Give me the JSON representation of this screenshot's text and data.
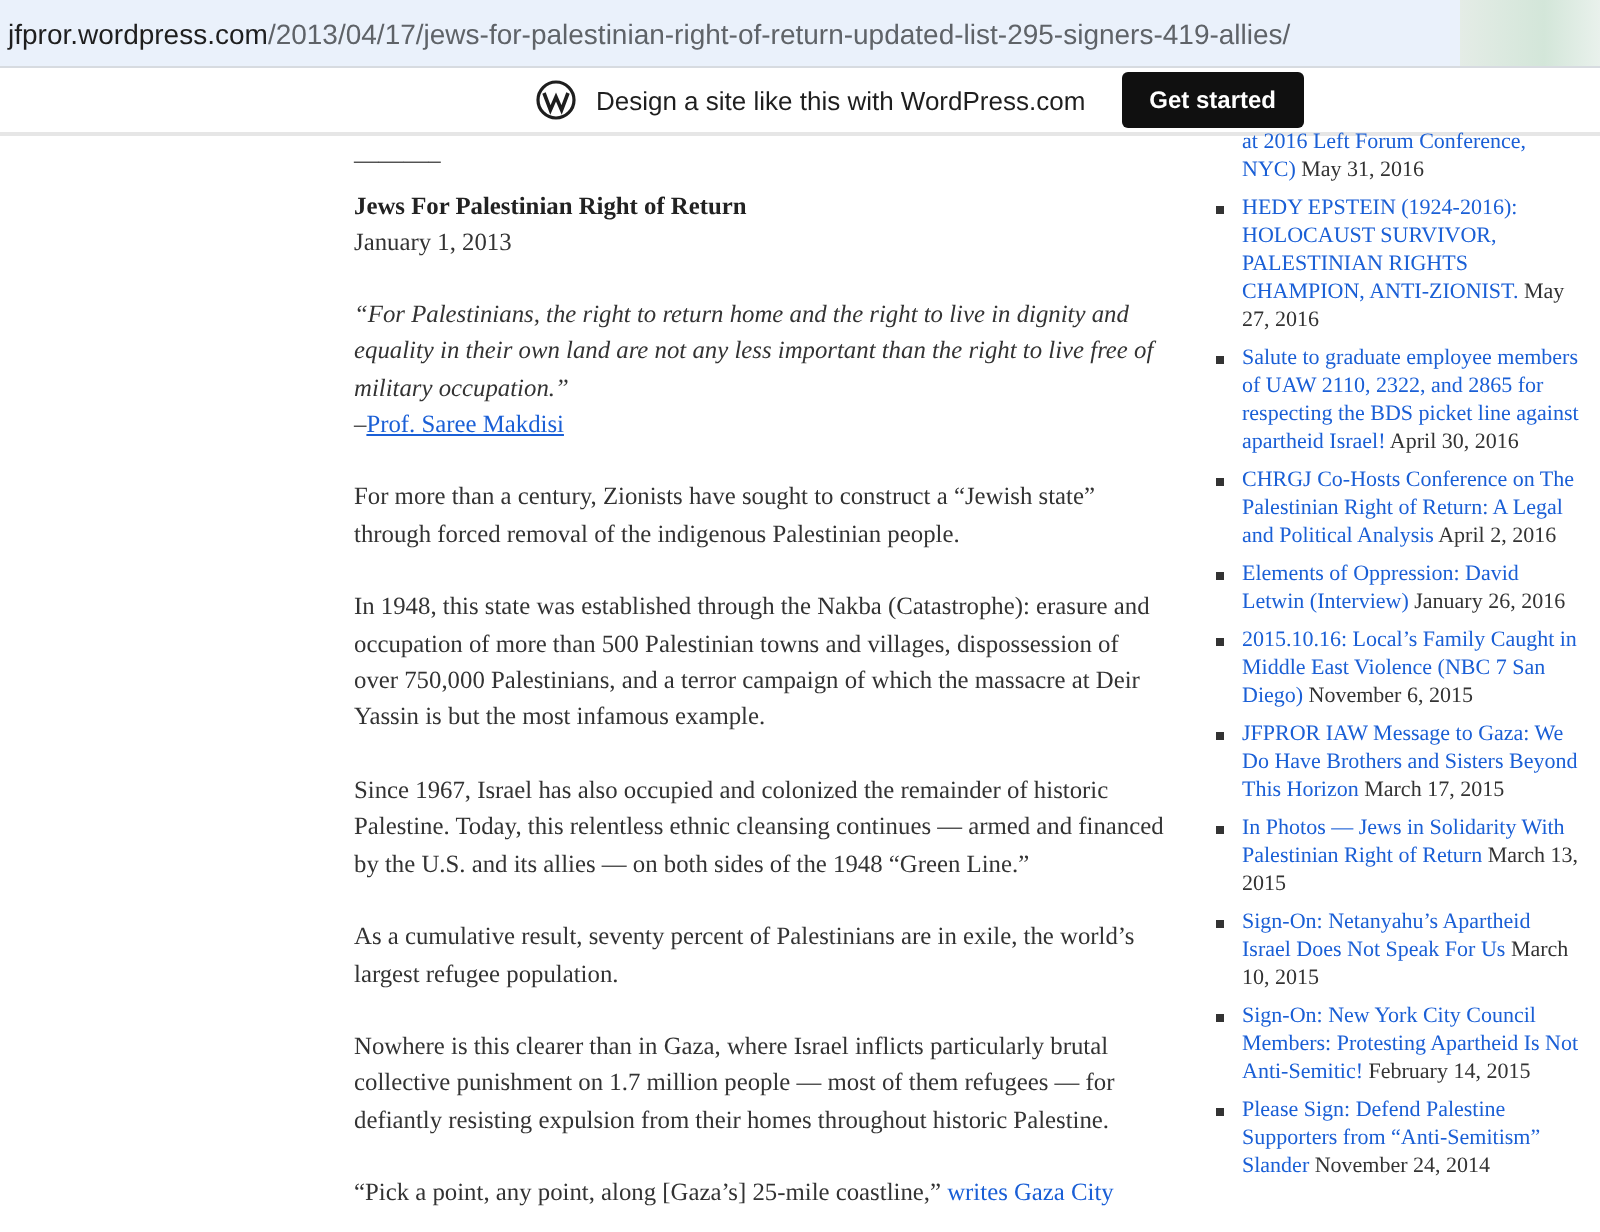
{
  "address_bar": {
    "host": "jfpror.wordpress.com",
    "path": "/2013/04/17/jews-for-palestinian-right-of-return-updated-list-295-signers-419-allies/"
  },
  "banner": {
    "text": "Design a site like this with WordPress.com",
    "button": "Get started"
  },
  "article": {
    "rule": "———–",
    "signer": "Jews For Palestinian Right of Return",
    "date": "January 1, 2013",
    "quote": "“For Palestinians, the right to return home and the right to live in dignity and equality in their own land are not any less important than the right to live free of military occupation.”",
    "attribution": {
      "dash": "–",
      "link": "Prof. Saree Makdisi"
    },
    "paragraphs": [
      {
        "text": "For more than a century, Zionists have sought to construct a “Jewish state” through forced removal of the indigenous Palestinian people."
      },
      {
        "text": "In 1948, this state was established through the Nakba (Catastrophe): erasure and occupation of more than 500 Palestinian towns and villages, dispossession of over 750,000 Palestinians, and a terror campaign of which the massacre at Deir Yassin is but the most infamous example."
      },
      {
        "text": "Since 1967, Israel has also occupied and colonized the remainder of historic Palestine. Today, this relentless ethnic cleansing continues — armed and financed by the U.S. and its allies — on both sides of the 1948 “Green Line.”"
      },
      {
        "text": "As a cumulative result, seventy percent of Palestinians are in exile, the world’s largest refugee population."
      },
      {
        "text": "Nowhere is this clearer than in Gaza, where Israel inflicts particularly brutal collective punishment on 1.7 million people — most of them refugees — for defiantly resisting expulsion from their homes throughout historic Palestine."
      },
      {
        "text": "“Pick a point, any point, along [Gaza’s] 25-mile coastline,” ",
        "link": "writes Gaza City"
      }
    ]
  },
  "sidebar": {
    "top_item": {
      "link": "at 2016 Left Forum Conference, NYC)",
      "date": "May 31, 2016"
    },
    "items": [
      {
        "link": "HEDY EPSTEIN (1924-2016): HOLOCAUST SURVIVOR, PALESTINIAN RIGHTS CHAMPION, ANTI-ZIONIST.",
        "date": "May 27, 2016"
      },
      {
        "link": "Salute to graduate employee members of UAW 2110, 2322, and 2865 for respecting the BDS picket line against apartheid Israel!",
        "date": "April 30, 2016"
      },
      {
        "link": "CHRGJ Co-Hosts Conference on The Palestinian Right of Return: A Legal and Political Analysis",
        "date": "April 2, 2016"
      },
      {
        "link": "Elements of Oppression: David Letwin (Interview)",
        "date": "January 26, 2016"
      },
      {
        "link": "2015.10.16: Local’s Family Caught in Middle East Violence (NBC 7 San Diego)",
        "date": "November 6, 2015"
      },
      {
        "link": "JFPROR IAW Message to Gaza: We Do Have Brothers and Sisters Beyond This Horizon",
        "date": "March 17, 2015"
      },
      {
        "link": "In Photos — Jews in Solidarity With Palestinian Right of Return",
        "date": "March 13, 2015"
      },
      {
        "link": "Sign-On: Netanyahu’s Apartheid Israel Does Not Speak For Us",
        "date": "March 10, 2015"
      },
      {
        "link": "Sign-On: New York City Council Members: Protesting Apartheid Is Not Anti-Semitic!",
        "date": "February 14, 2015"
      },
      {
        "link": "Please Sign: Defend Palestine Supporters from “Anti-Semitism” Slander",
        "date": "November 24, 2014"
      }
    ]
  }
}
